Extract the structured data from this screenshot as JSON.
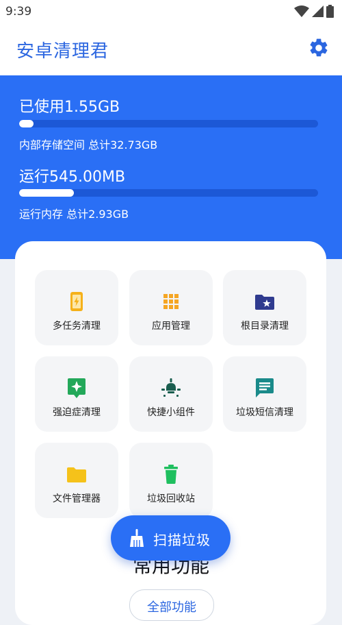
{
  "status_bar": {
    "time": "9:39"
  },
  "app_bar": {
    "title": "安卓清理君"
  },
  "storage": {
    "used_text": "已使用1.55GB",
    "detail_text": "内部存储空间 总计32.73GB",
    "used_fraction": 0.047
  },
  "memory": {
    "used_text": "运行545.00MB",
    "detail_text": "运行内存 总计2.93GB",
    "used_fraction": 0.182
  },
  "tools": [
    {
      "label": "多任务清理",
      "icon": "phone-charging-icon",
      "color": "#f5b11a"
    },
    {
      "label": "应用管理",
      "icon": "apps-grid-icon",
      "color": "#f5a623"
    },
    {
      "label": "根目录清理",
      "icon": "folder-star-icon",
      "color": "#2f3b8f"
    },
    {
      "label": "强迫症清理",
      "icon": "sparkle-icon",
      "color": "#23a85a"
    },
    {
      "label": "快捷小组件",
      "icon": "light-icon",
      "color": "#1a5e4f"
    },
    {
      "label": "垃圾短信清理",
      "icon": "message-icon",
      "color": "#1a8a8a"
    },
    {
      "label": "文件管理器",
      "icon": "folder-icon",
      "color": "#f5c21a"
    },
    {
      "label": "垃圾回收站",
      "icon": "trash-icon",
      "color": "#1fbf5f"
    }
  ],
  "fab": {
    "label": "扫描垃圾"
  },
  "section": {
    "title": "常用功能",
    "all_label": "全部功能"
  }
}
